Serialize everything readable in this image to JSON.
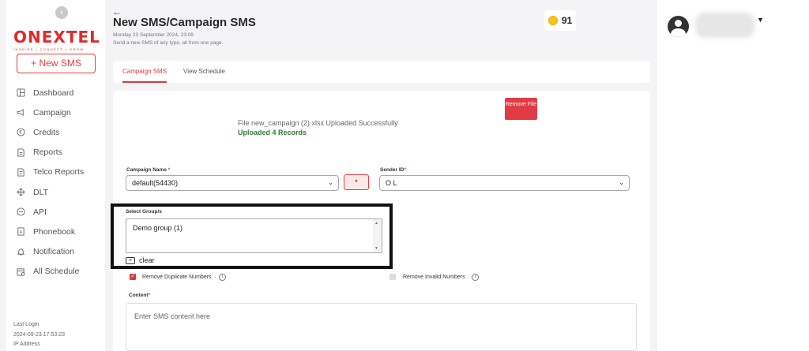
{
  "sidebar": {
    "brand": "ONEXTEL",
    "tagline": "INSPIRE • CONNECT • GROW",
    "new_sms_label": "+ New SMS",
    "items": [
      {
        "label": "Dashboard",
        "icon": "dashboard-icon"
      },
      {
        "label": "Campaign",
        "icon": "megaphone-icon"
      },
      {
        "label": "Credits",
        "icon": "credits-icon"
      },
      {
        "label": "Reports",
        "icon": "reports-icon"
      },
      {
        "label": "Telco Reports",
        "icon": "telco-reports-icon"
      },
      {
        "label": "DLT",
        "icon": "dlt-icon"
      },
      {
        "label": "API",
        "icon": "api-icon"
      },
      {
        "label": "Phonebook",
        "icon": "phonebook-icon"
      },
      {
        "label": "Notification",
        "icon": "bell-icon"
      },
      {
        "label": "All Schedule",
        "icon": "calendar-icon"
      }
    ],
    "last_login_label": "Last Login",
    "last_login_value": "2024-09-23 17:53:23",
    "ip_label": "IP Address"
  },
  "header": {
    "title": "New SMS/Campaign SMS",
    "date": "Monday 23 September 2024, 23:09",
    "subtitle": "Send a new SMS of any type, all from one page.",
    "credits": "91"
  },
  "tabs": [
    {
      "label": "Campaign SMS",
      "active": true
    },
    {
      "label": "View Schedule",
      "active": false
    }
  ],
  "upload": {
    "remove_file_label": "Remove File",
    "message": "File new_campaign (2).xlsx Uploaded Successfully",
    "records": "Uploaded 4 Records"
  },
  "form": {
    "campaign_name_label": "Campaign Name",
    "campaign_name_value": "default(54430)",
    "star_button": "*",
    "sender_id_label": "Sender ID",
    "sender_id_value": "O      L",
    "select_groups_label": "Select Group/s",
    "groups": [
      "Demo group (1)"
    ],
    "clear_label": "clear",
    "remove_duplicates_label": "Remove Duplicate Numbers",
    "remove_invalid_label": "Remove Invalid Numbers",
    "content_label": "Content",
    "content_placeholder": "Enter SMS content here"
  },
  "colors": {
    "accent": "#d93b3b",
    "success": "#2e7d32",
    "highlight_frame": "#111111"
  }
}
